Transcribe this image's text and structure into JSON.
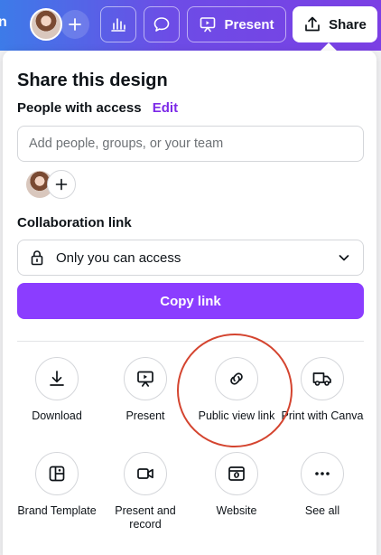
{
  "topbar": {
    "edge_text": "n",
    "present_label": "Present",
    "share_label": "Share"
  },
  "panel": {
    "title": "Share this design",
    "people_label": "People with access",
    "edit_label": "Edit",
    "add_placeholder": "Add people, groups, or your team",
    "collab_label": "Collaboration link",
    "access_value": "Only you can access",
    "copy_label": "Copy link"
  },
  "options": [
    {
      "label": "Download",
      "icon": "download-icon"
    },
    {
      "label": "Present",
      "icon": "present-icon"
    },
    {
      "label": "Public view link",
      "icon": "link-icon"
    },
    {
      "label": "Print with Canva",
      "icon": "truck-icon"
    },
    {
      "label": "Brand Template",
      "icon": "brand-template-icon"
    },
    {
      "label": "Present and record",
      "icon": "video-camera-icon"
    },
    {
      "label": "Website",
      "icon": "website-icon"
    },
    {
      "label": "See all",
      "icon": "more-icon"
    }
  ],
  "colors": {
    "primary": "#8b3dff",
    "edit_link": "#7d2ae8",
    "highlight_ring": "#d4442f"
  }
}
